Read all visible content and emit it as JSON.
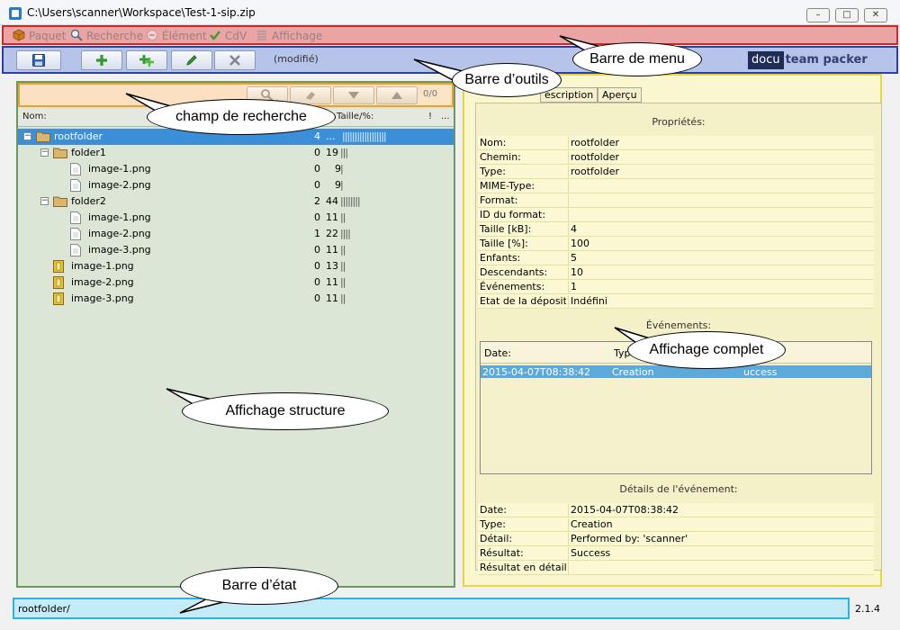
{
  "window": {
    "title": "C:\\Users\\scanner\\Workspace\\Test-1-sip.zip",
    "controls": [
      "minimize",
      "maximize",
      "close"
    ]
  },
  "menu": {
    "items": [
      "Paquet",
      "Recherche",
      "Élément",
      "CdV",
      "Affichage"
    ]
  },
  "toolbar": {
    "status": "(modifié)",
    "logo_dark": "docu",
    "logo_light": "team packer"
  },
  "search": {
    "value": "",
    "placeholder": "",
    "count": "0/0"
  },
  "tree": {
    "headers": {
      "name": "Nom:",
      "size": "Taille/%:",
      "flag": "!",
      "more": "..."
    },
    "rows": [
      {
        "label": "rootfolder",
        "count": "4",
        "size": "...",
        "bars": 18,
        "type": "folder",
        "selected": true,
        "expanded": true
      },
      {
        "label": "folder1",
        "count": "0",
        "size": "19",
        "bars": 3,
        "type": "folder",
        "expanded": true
      },
      {
        "label": "image-1.png",
        "count": "0",
        "size": "9",
        "bars": 1,
        "type": "file"
      },
      {
        "label": "image-2.png",
        "count": "0",
        "size": "9",
        "bars": 1,
        "type": "file"
      },
      {
        "label": "folder2",
        "count": "2",
        "size": "44",
        "bars": 8,
        "type": "folder",
        "expanded": true
      },
      {
        "label": "image-1.png",
        "count": "0",
        "size": "11",
        "bars": 2,
        "type": "file"
      },
      {
        "label": "image-2.png",
        "count": "1",
        "size": "22",
        "bars": 4,
        "type": "file"
      },
      {
        "label": "image-3.png",
        "count": "0",
        "size": "11",
        "bars": 2,
        "type": "file"
      },
      {
        "label": "image-1.png",
        "count": "0",
        "size": "13",
        "bars": 2,
        "type": "file-yellow"
      },
      {
        "label": "image-2.png",
        "count": "0",
        "size": "11",
        "bars": 2,
        "type": "file-yellow"
      },
      {
        "label": "image-3.png",
        "count": "0",
        "size": "11",
        "bars": 2,
        "type": "file-yellow"
      }
    ]
  },
  "details": {
    "tabs": [
      "escription",
      "Aperçu"
    ],
    "properties_title": "Propriétés:",
    "properties": [
      {
        "key": "Nom:",
        "value": "rootfolder"
      },
      {
        "key": "Chemin:",
        "value": "rootfolder"
      },
      {
        "key": "Type:",
        "value": "rootfolder"
      },
      {
        "key": "MIME-Type:",
        "value": ""
      },
      {
        "key": "Format:",
        "value": ""
      },
      {
        "key": "ID du format:",
        "value": ""
      },
      {
        "key": "Taille [kB]:",
        "value": "4"
      },
      {
        "key": "Taille [%]:",
        "value": "100"
      },
      {
        "key": "Enfants:",
        "value": "5"
      },
      {
        "key": "Descendants:",
        "value": "10"
      },
      {
        "key": "Événements:",
        "value": "1"
      },
      {
        "key": "Etat de la déposit...",
        "value": "Indéfini"
      }
    ],
    "events_title": "Événements:",
    "events_headers": [
      "Date:",
      "Typ"
    ],
    "events": [
      {
        "date": "2015-04-07T08:38:42",
        "type": "Creation",
        "result": "uccess"
      }
    ],
    "event_details_title": "Détails de l'événement:",
    "event_details": [
      {
        "key": "Date:",
        "value": "2015-04-07T08:38:42"
      },
      {
        "key": "Type:",
        "value": "Creation"
      },
      {
        "key": "Détail:",
        "value": "Performed by: 'scanner'"
      },
      {
        "key": "Résultat:",
        "value": "Success"
      },
      {
        "key": "Résultat en détail:",
        "value": ""
      }
    ]
  },
  "statusbar": {
    "path": "rootfolder/",
    "version": "2.1.4"
  },
  "callouts": {
    "menu": "Barre de menu",
    "toolbar": "Barre d’outils",
    "search": "champ de recherche",
    "full": "Affichage complet",
    "structure": "Affichage structure",
    "status": "Barre d’état"
  },
  "colors": {
    "menu_fill": "#eaa4a4",
    "menu_border": "#cc2a2a",
    "toolbar_fill": "#b7c4ea",
    "toolbar_border": "#2f3f9f",
    "search_fill": "#fbe3c6",
    "search_border": "#ee9d2e",
    "tree_fill": "#dbe6d6",
    "tree_border": "#6a9a5e",
    "details_fill": "#faf6cf",
    "details_border": "#e8d63c",
    "status_fill": "#c4ebf7",
    "status_border": "#27b4de",
    "selection": "#3a8fd8"
  }
}
